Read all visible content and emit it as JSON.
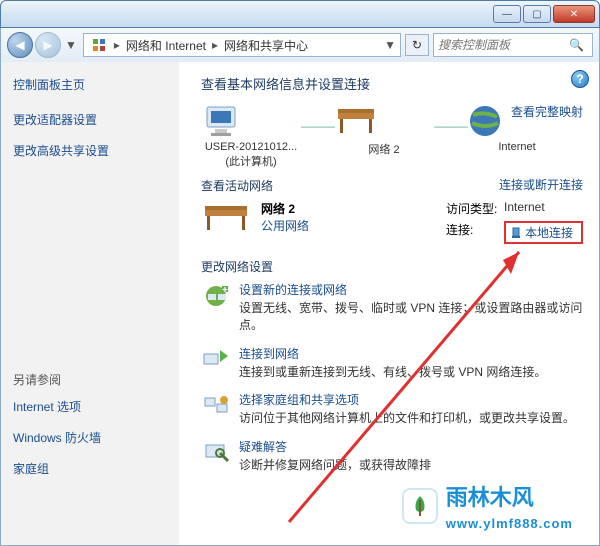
{
  "titlebar": {
    "min": "—",
    "max": "▢",
    "close": "✕"
  },
  "nav": {
    "back_glyph": "◀",
    "fwd_glyph": "▶",
    "dd_glyph": "▼",
    "crumb1": "网络和 Internet",
    "crumb2": "网络和共享中心",
    "refresh_glyph": "↻",
    "search_placeholder": "搜索控制面板",
    "search_glyph": "🔍"
  },
  "sidebar": {
    "home": "控制面板主页",
    "link_adapter": "更改适配器设置",
    "link_advanced": "更改高级共享设置",
    "other_title": "另请参阅",
    "link_ie": "Internet 选项",
    "link_fw": "Windows 防火墙",
    "link_hg": "家庭组"
  },
  "help_glyph": "?",
  "main_heading": "查看基本网络信息并设置连接",
  "map": {
    "pc_name": "USER-20121012...",
    "pc_sub": "(此计算机)",
    "net_name": "网络  2",
    "internet": "Internet",
    "full_map_link": "查看完整映射",
    "dash": "———"
  },
  "active": {
    "section": "查看活动网络",
    "conn_link": "连接或断开连接",
    "name": "网络  2",
    "type": "公用网络",
    "access_label": "访问类型:",
    "access_value": "Internet",
    "conn_label": "连接:",
    "conn_value": "本地连接"
  },
  "change_section": "更改网络设置",
  "settings": {
    "s1_title": "设置新的连接或网络",
    "s1_desc": "设置无线、宽带、拨号、临时或 VPN 连接；或设置路由器或访问点。",
    "s2_title": "连接到网络",
    "s2_desc": "连接到或重新连接到无线、有线、拨号或 VPN 网络连接。",
    "s3_title": "选择家庭组和共享选项",
    "s3_desc": "访问位于其他网络计算机上的文件和打印机，或更改共享设置。",
    "s4_title": "疑难解答",
    "s4_desc": "诊断并修复网络问题，或获得故障排"
  },
  "watermark": {
    "brand": "雨林木风",
    "url": "www.ylmf888.com"
  },
  "colors": {
    "link": "#1a4d8f",
    "annotation": "#e03030"
  }
}
